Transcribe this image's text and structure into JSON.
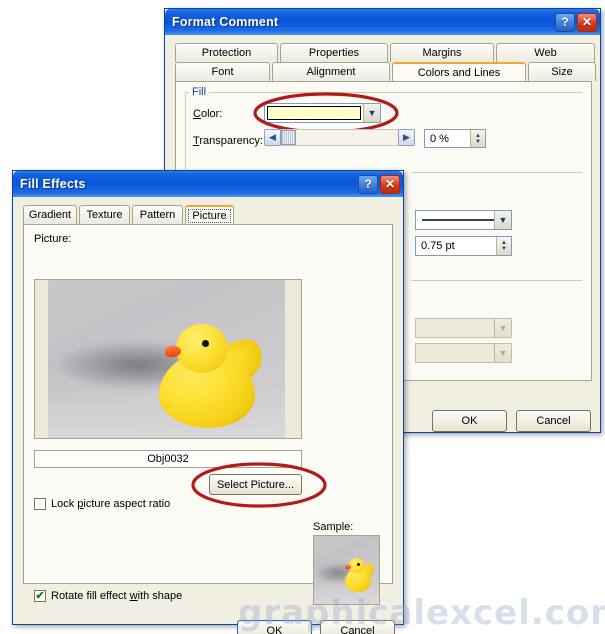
{
  "watermark": {
    "text": "graphicalexcel.com"
  },
  "format_comment": {
    "title": "Format Comment",
    "help_icon": "?",
    "close_icon": "✕",
    "tabs_row1": [
      {
        "label": "Protection"
      },
      {
        "label": "Properties"
      },
      {
        "label": "Margins"
      },
      {
        "label": "Web"
      }
    ],
    "tabs_row2": [
      {
        "label": "Font"
      },
      {
        "label": "Alignment"
      },
      {
        "label": "Colors and Lines"
      },
      {
        "label": "Size"
      }
    ],
    "active_tab": "Colors and Lines",
    "fill": {
      "group_label": "Fill",
      "color_label": "Color:",
      "color_value": "",
      "color_swatch": "#ffffcc",
      "transparency_label": "Transparency:",
      "transparency_value": "0 %",
      "left_arrow": "◀",
      "right_arrow": "▶"
    },
    "line": {
      "style_value": "",
      "weight_value": "0.75 pt"
    },
    "arrows": {
      "dropdown1_value": "",
      "dropdown2_value": ""
    },
    "buttons": {
      "ok": "OK",
      "cancel": "Cancel"
    }
  },
  "fill_effects": {
    "title": "Fill Effects",
    "help_icon": "?",
    "close_icon": "✕",
    "tabs": [
      {
        "label": "Gradient"
      },
      {
        "label": "Texture"
      },
      {
        "label": "Pattern"
      },
      {
        "label": "Picture"
      }
    ],
    "active_tab": "Picture",
    "picture_label": "Picture:",
    "picture_name": "Obj0032",
    "select_picture_button": "Select Picture...",
    "lock_aspect_label": "Lock picture aspect ratio",
    "lock_aspect_checked": false,
    "rotate_fill_label": "Rotate fill effect with shape",
    "rotate_fill_checked": true,
    "rotate_fill_check_glyph": "✔",
    "sample_label": "Sample:",
    "buttons": {
      "ok": "OK",
      "cancel": "Cancel"
    }
  }
}
